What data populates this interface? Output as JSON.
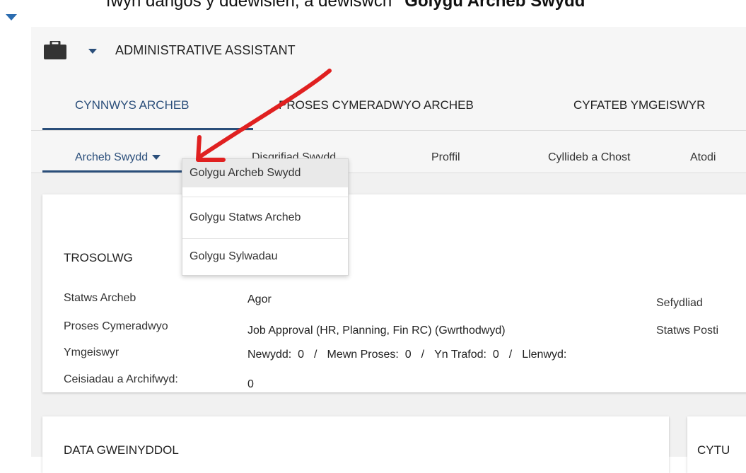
{
  "caption": {
    "prefix": "fwyn dangos y ddewisien, a dewiswch ",
    "bold": "\"Golygu Archeb Swydd\""
  },
  "header": {
    "title": "ADMINISTRATIVE ASSISTANT",
    "icon": "briefcase-icon"
  },
  "main_tabs": [
    {
      "label": "CYNNWYS ARCHEB",
      "active": true
    },
    {
      "label": "PROSES CYMERADWYO ARCHEB",
      "active": false
    },
    {
      "label": "CYFATEB YMGEISWYR",
      "active": false
    }
  ],
  "sub_tabs": [
    {
      "label": "Archeb Swydd",
      "active": true
    },
    {
      "label": "Disgrifiad Swydd",
      "active": false
    },
    {
      "label": "Proffil",
      "active": false
    },
    {
      "label": "Cyllideb a Chost",
      "active": false
    },
    {
      "label": "Atodi",
      "active": false
    }
  ],
  "dropdown": {
    "items": [
      {
        "label": "Golygu Archeb Swydd",
        "highlighted": true
      },
      {
        "label": "Golygu Statws Archeb",
        "highlighted": false
      },
      {
        "label": "Golygu Sylwadau",
        "highlighted": false
      }
    ]
  },
  "overview": {
    "title": "TROSOLWG",
    "fields": [
      {
        "label": "Statws Archeb",
        "value": "Agor"
      },
      {
        "label": "Proses Cymeradwyo",
        "value": "Job Approval (HR, Planning, Fin RC) (Gwrthodwyd)"
      },
      {
        "label": "Ymgeiswyr",
        "value": ""
      },
      {
        "label": "Ceisiadau a Archifwyd:",
        "value": "0"
      }
    ],
    "right_labels": [
      "Sefydliad",
      "Statws Posti"
    ],
    "counts": [
      {
        "label": "Newydd:",
        "value": "0"
      },
      {
        "label": "Mewn Proses:",
        "value": "0"
      },
      {
        "label": "Yn Trafod:",
        "value": "0"
      },
      {
        "label": "Llenwyd:",
        "value": ""
      }
    ],
    "separator": "/"
  },
  "admin_data": {
    "title": "DATA GWEINYDDOL"
  },
  "right_card": {
    "title": "CYTU"
  },
  "colors": {
    "accent": "#2a4e7a",
    "annotation": "#e02020"
  }
}
